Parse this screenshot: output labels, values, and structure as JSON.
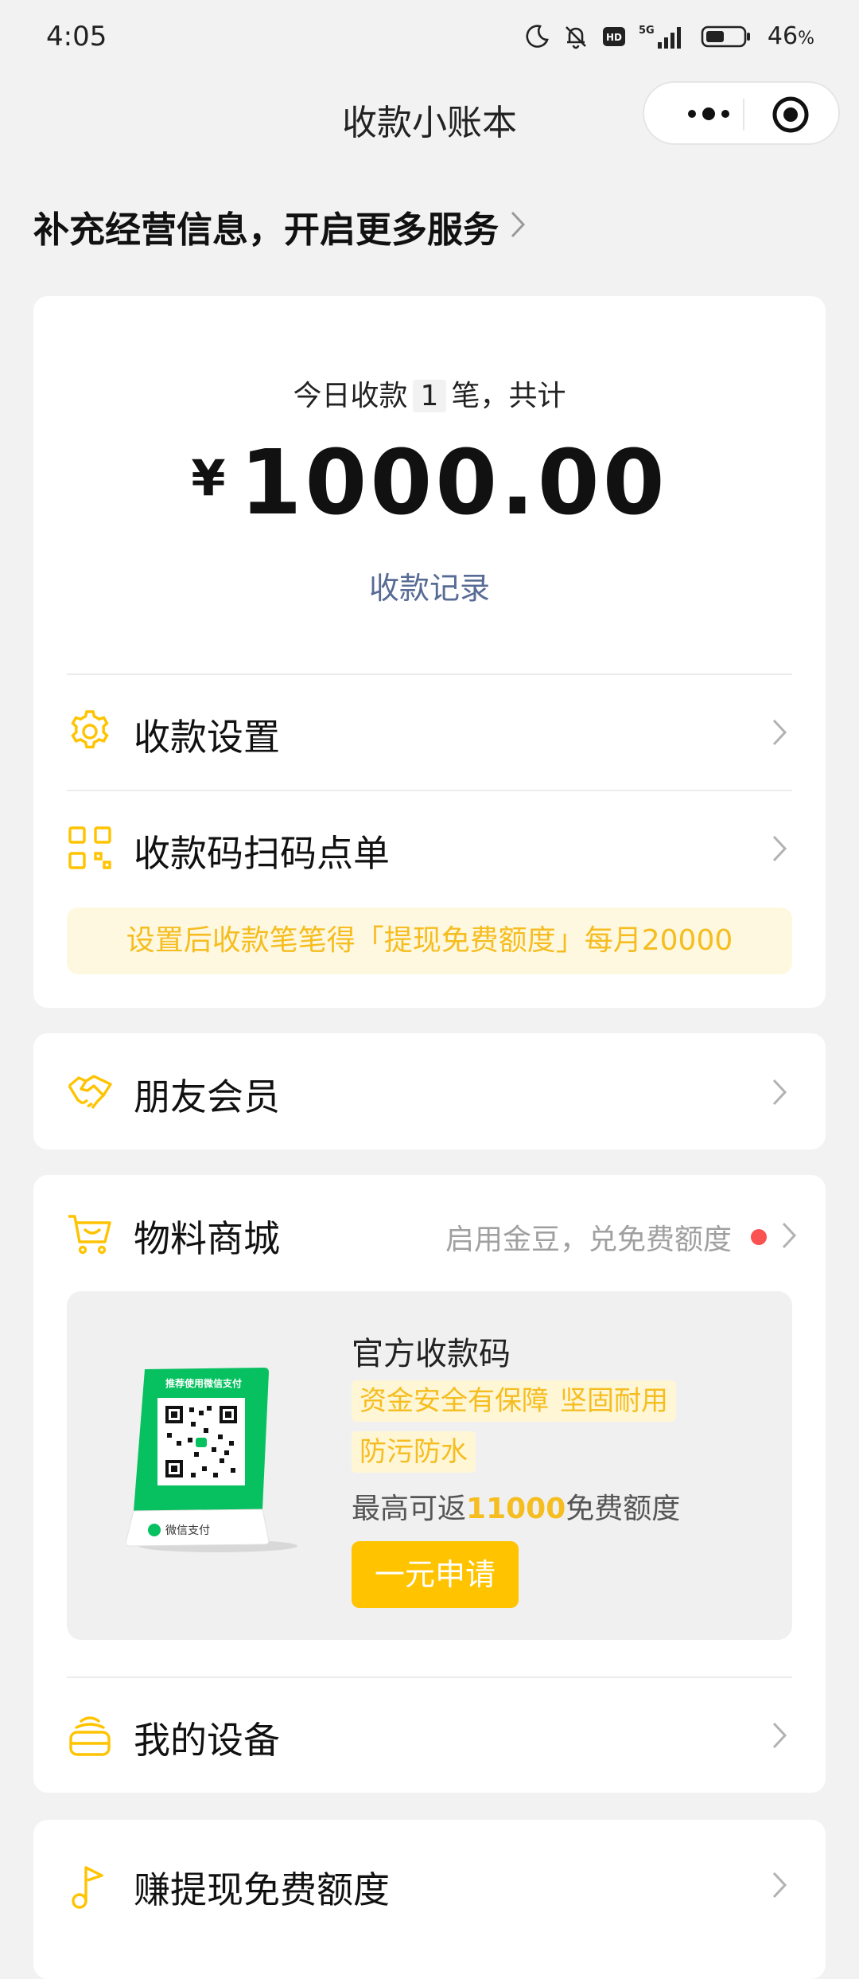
{
  "status_bar": {
    "time": "4:05",
    "network": "5G",
    "battery_percent": "46",
    "battery_symbol": "%"
  },
  "header": {
    "title": "收款小账本"
  },
  "business_info_link": "补充经营信息，开启更多服务",
  "summary": {
    "prefix": "今日收款",
    "count": "1",
    "suffix": "笔，共计",
    "currency": "¥",
    "amount": "1000.00",
    "records_link": "收款记录"
  },
  "menu": {
    "settings": "收款设置",
    "qr_order": "收款码扫码点单",
    "promo": "设置后收款笔笔得「提现免费额度」每月20000",
    "friend_member": "朋友会员",
    "mall": "物料商城",
    "mall_hint": "启用金豆，兑免费额度",
    "my_devices": "我的设备",
    "earn_quota": "赚提现免费额度"
  },
  "product": {
    "title": "官方收款码",
    "tags": [
      "资金安全有保障",
      "坚固耐用",
      "防污防水"
    ],
    "rebate_prefix": "最高可返",
    "rebate_amount": "11000",
    "rebate_suffix": "免费额度",
    "button": "一元申请",
    "image_text_top": "推荐使用微信支付",
    "image_text_brand": "微信支付"
  },
  "colors": {
    "accent_yellow": "#ffc300",
    "tag_text": "#f5bd1f",
    "link_blue": "#576b95",
    "badge_red": "#fa5151",
    "wechat_green": "#07c160"
  }
}
